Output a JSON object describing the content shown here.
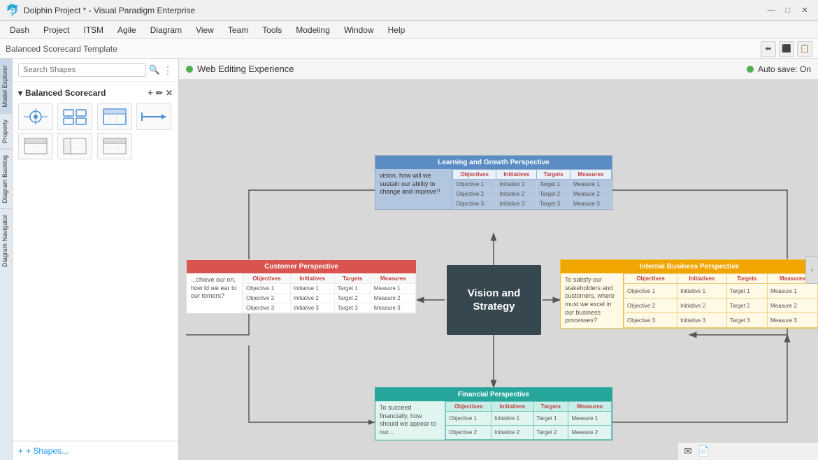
{
  "titleBar": {
    "appIcon": "🐬",
    "title": "Dolphin Project * - Visual Paradigm Enterprise",
    "controls": {
      "minimize": "—",
      "maximize": "□",
      "close": "✕"
    }
  },
  "menuBar": {
    "items": [
      "Dash",
      "Project",
      "ITSM",
      "Agile",
      "Diagram",
      "View",
      "Team",
      "Tools",
      "Modeling",
      "Window",
      "Help"
    ]
  },
  "breadcrumb": {
    "label": "Balanced Scorecard Template"
  },
  "leftPanel": {
    "searchPlaceholder": "Search Shapes",
    "sectionLabel": "Balanced Scorecard",
    "addShapesLabel": "+ Shapes..."
  },
  "canvasTopbar": {
    "webEditing": "Web Editing Experience",
    "autoSave": "Auto save: On"
  },
  "visionBox": {
    "text": "Vision and Strategy"
  },
  "learningPerspective": {
    "header": "Learning and Growth Perspective",
    "description": "vision, how will we sustain our ability to change and improve?",
    "columns": [
      "Objectives",
      "Initiatives",
      "Targets",
      "Measures"
    ],
    "rows": [
      [
        "Objective 1",
        "Initiative 1",
        "Target 1",
        "Measure 1"
      ],
      [
        "Objective 2",
        "Initiative 2",
        "Target 2",
        "Measure 2"
      ],
      [
        "Objective 3",
        "Initiative 3",
        "Target 3",
        "Measure 3"
      ]
    ],
    "color": "#5b8cc4"
  },
  "customerPerspective": {
    "header": "Customer Perspective",
    "description": "...chieve our on, how ld we ear to our tomers?",
    "columns": [
      "Objectives",
      "Initiatives",
      "Targets",
      "Measures"
    ],
    "rows": [
      [
        "Objective 1",
        "Initiative 1",
        "Target 1",
        "Measure 1"
      ],
      [
        "Objective 2",
        "Initiative 2",
        "Target 2",
        "Measure 2"
      ],
      [
        "Objective 3",
        "Initiative 3",
        "Target 3",
        "Measure 3"
      ]
    ],
    "color": "#d9534f"
  },
  "internalPerspective": {
    "header": "Internal Business Perspective",
    "description": "To satisfy our stakeholders and customers, where must we excel in our business processes?",
    "columns": [
      "Objectives",
      "Initiatives",
      "Targets",
      "Measures"
    ],
    "rows": [
      [
        "Objective 1",
        "Initiative 1",
        "Target 1",
        "Measure 1"
      ],
      [
        "Objective 2",
        "Initiative 2",
        "Target 2",
        "Measure 2"
      ],
      [
        "Objective 3",
        "Initiative 3",
        "Target 3",
        "Measure 3"
      ]
    ],
    "color": "#f0a500"
  },
  "financialPerspective": {
    "header": "Financial Perspective",
    "description": "To succeed financially, how should we appear to our...",
    "columns": [
      "Objectives",
      "Initiatives",
      "Targets",
      "Measures"
    ],
    "rows": [
      [
        "Objective 1",
        "Initiative 1",
        "Target 1",
        "Measure 1"
      ],
      [
        "Objective 2",
        "Initiative 2",
        "Target 2",
        "Measure 2"
      ]
    ],
    "color": "#26a69a"
  },
  "sideTabs": {
    "modelExplorer": "Model Explorer",
    "property": "Property",
    "diagramBacklog": "Diagram Backlog",
    "diagramNavigator": "Diagram Navigator"
  },
  "bottomIcons": {
    "email": "✉",
    "export": "📄"
  }
}
